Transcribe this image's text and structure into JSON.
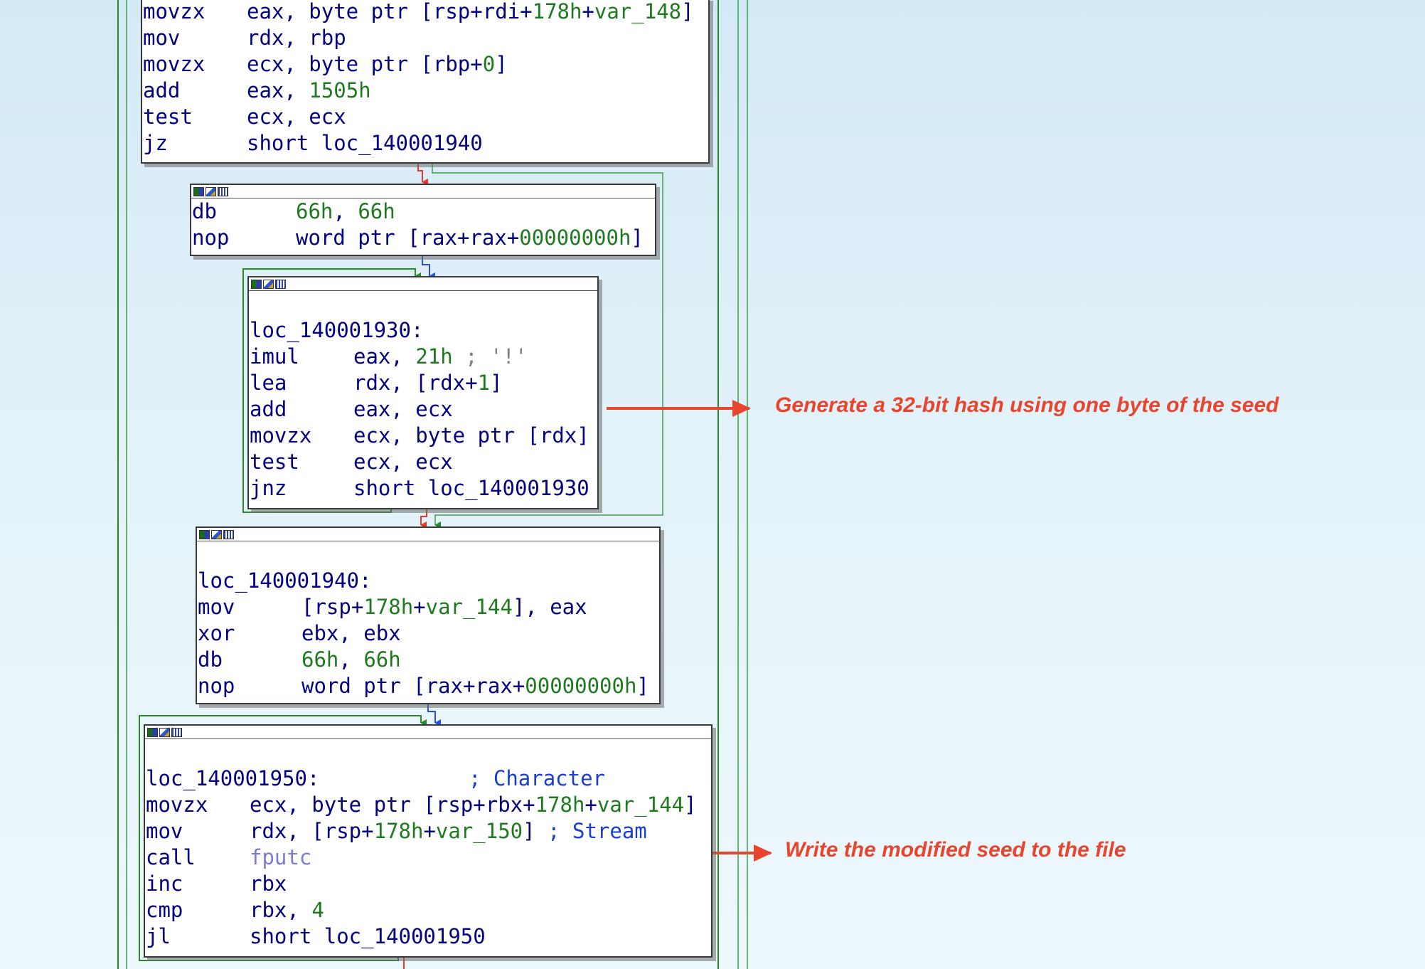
{
  "blocks": [
    {
      "id": "block-top",
      "lines": [
        {
          "mn": "movzx",
          "ops": [
            {
              "t": "eax, byte ptr [rsp+rdi+"
            },
            {
              "t": "178h",
              "k": "n"
            },
            {
              "t": "+"
            },
            {
              "t": "var_148",
              "k": "n"
            },
            {
              "t": "]"
            }
          ]
        },
        {
          "mn": "mov",
          "ops": [
            {
              "t": "rdx, rbp"
            }
          ]
        },
        {
          "mn": "movzx",
          "ops": [
            {
              "t": "ecx, byte ptr [rbp+"
            },
            {
              "t": "0",
              "k": "n"
            },
            {
              "t": "]"
            }
          ]
        },
        {
          "mn": "add",
          "ops": [
            {
              "t": "eax, "
            },
            {
              "t": "1505h",
              "k": "n"
            }
          ]
        },
        {
          "mn": "test",
          "ops": [
            {
              "t": "ecx, ecx"
            }
          ]
        },
        {
          "mn": "jz",
          "ops": [
            {
              "t": "short loc_140001940"
            }
          ]
        }
      ]
    },
    {
      "id": "block-db",
      "lines": [
        {
          "mn": "db",
          "ops": [
            {
              "t": "66h",
              "k": "n"
            },
            {
              "t": ", "
            },
            {
              "t": "66h",
              "k": "n"
            }
          ]
        },
        {
          "mn": "nop",
          "ops": [
            {
              "t": "word ptr [rax+rax+"
            },
            {
              "t": "00000000h",
              "k": "n"
            },
            {
              "t": "]"
            }
          ]
        }
      ]
    },
    {
      "id": "block-loop-930",
      "lines": [
        {
          "blank": true
        },
        {
          "label": "loc_140001930:"
        },
        {
          "mn": "imul",
          "ops": [
            {
              "t": "eax, "
            },
            {
              "t": "21h",
              "k": "n"
            },
            {
              "t": " ; '!'",
              "k": "c"
            }
          ]
        },
        {
          "mn": "lea",
          "ops": [
            {
              "t": "rdx, [rdx+"
            },
            {
              "t": "1",
              "k": "n"
            },
            {
              "t": "]"
            }
          ]
        },
        {
          "mn": "add",
          "ops": [
            {
              "t": "eax, ecx"
            }
          ]
        },
        {
          "mn": "movzx",
          "ops": [
            {
              "t": "ecx, byte ptr [rdx]"
            }
          ]
        },
        {
          "mn": "test",
          "ops": [
            {
              "t": "ecx, ecx"
            }
          ]
        },
        {
          "mn": "jnz",
          "ops": [
            {
              "t": "short loc_140001930"
            }
          ]
        }
      ]
    },
    {
      "id": "block-940",
      "lines": [
        {
          "blank": true
        },
        {
          "label": "loc_140001940:"
        },
        {
          "mn": "mov",
          "ops": [
            {
              "t": "[rsp+"
            },
            {
              "t": "178h",
              "k": "n"
            },
            {
              "t": "+"
            },
            {
              "t": "var_144",
              "k": "n"
            },
            {
              "t": "], eax"
            }
          ]
        },
        {
          "mn": "xor",
          "ops": [
            {
              "t": "ebx, ebx"
            }
          ]
        },
        {
          "mn": "db",
          "ops": [
            {
              "t": "66h",
              "k": "n"
            },
            {
              "t": ", "
            },
            {
              "t": "66h",
              "k": "n"
            }
          ]
        },
        {
          "mn": "nop",
          "ops": [
            {
              "t": "word ptr [rax+rax+"
            },
            {
              "t": "00000000h",
              "k": "n"
            },
            {
              "t": "]"
            }
          ]
        }
      ]
    },
    {
      "id": "block-loop-950",
      "lines": [
        {
          "blank": true
        },
        {
          "label": "loc_140001950:",
          "comment": "            ; Character"
        },
        {
          "mn": "movzx",
          "ops": [
            {
              "t": "ecx, byte ptr [rsp+rbx+"
            },
            {
              "t": "178h",
              "k": "n"
            },
            {
              "t": "+"
            },
            {
              "t": "var_144",
              "k": "n"
            },
            {
              "t": "]"
            }
          ]
        },
        {
          "mn": "mov",
          "ops": [
            {
              "t": "rdx, [rsp+"
            },
            {
              "t": "178h",
              "k": "n"
            },
            {
              "t": "+"
            },
            {
              "t": "var_150",
              "k": "n"
            },
            {
              "t": "] "
            },
            {
              "t": "; Stream",
              "k": "cc"
            }
          ]
        },
        {
          "mn": "call",
          "ops": [
            {
              "t": "fputc",
              "k": "fn"
            }
          ]
        },
        {
          "mn": "inc",
          "ops": [
            {
              "t": "rbx"
            }
          ]
        },
        {
          "mn": "cmp",
          "ops": [
            {
              "t": "rbx, "
            },
            {
              "t": "4",
              "k": "n"
            }
          ]
        },
        {
          "mn": "jl",
          "ops": [
            {
              "t": "short loc_140001950"
            }
          ]
        }
      ]
    }
  ],
  "annotations": {
    "hash": "Generate a 32-bit hash using one byte of the seed",
    "write": "Write the modified seed to the file"
  },
  "colors": {
    "annotation": "#e8452f",
    "edge_true": "#2a8a2a",
    "edge_false": "#e23a2a",
    "edge_uncond": "#2a50e0"
  }
}
